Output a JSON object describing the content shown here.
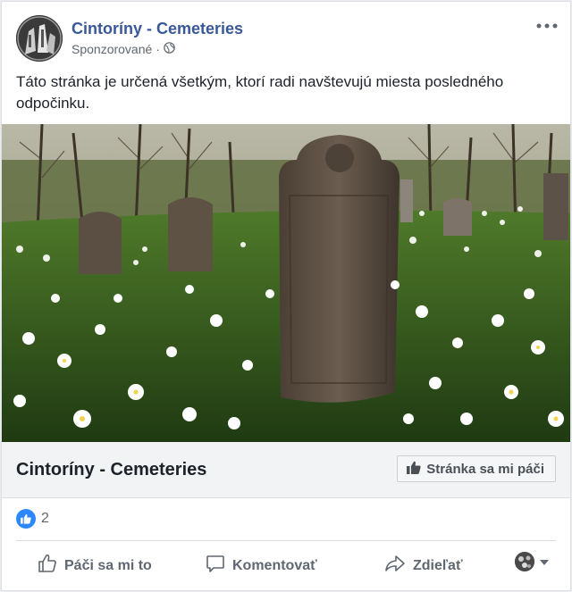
{
  "post": {
    "page_name": "Cintoríny - Cemeteries",
    "sponsored_label": "Sponzorované",
    "separator": "·",
    "message": "Táto stránka je určená všetkým, ktorí radi navštevujú miesta posledného odpočinku.",
    "more_icon": "more-horizontal-icon",
    "privacy_icon": "globe-icon"
  },
  "cta": {
    "title": "Cintoríny - Cemeteries",
    "like_page_label": "Stránka sa mi páči",
    "icon": "thumbs-up-icon"
  },
  "reactions": {
    "count": "2",
    "icon": "like-reaction-icon",
    "color": "#2d88ff"
  },
  "actions": {
    "like_label": "Páči sa mi to",
    "comment_label": "Komentovať",
    "share_label": "Zdieľať",
    "like_icon": "thumbs-up-outline-icon",
    "comment_icon": "speech-bubble-icon",
    "share_icon": "share-arrow-icon",
    "audience_icon": "chevron-down-icon"
  },
  "colors": {
    "link": "#385898",
    "meta": "#606770",
    "cta_background": "#f2f3f5"
  }
}
